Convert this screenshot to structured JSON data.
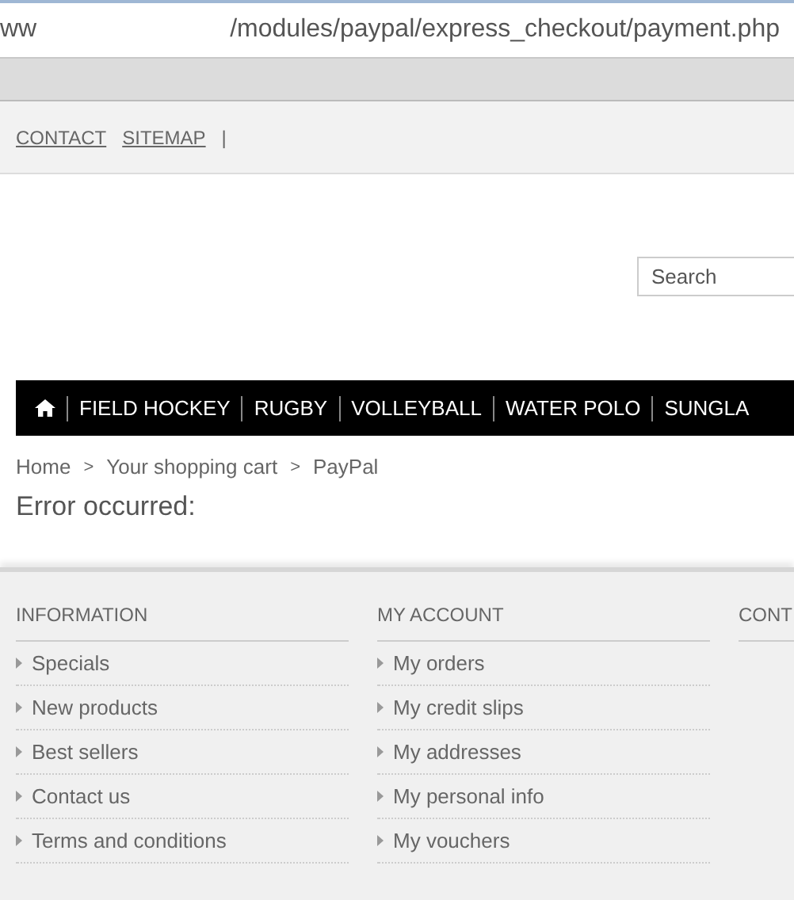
{
  "address_bar": {
    "prefix": "ww",
    "path": "/modules/paypal/express_checkout/payment.php"
  },
  "top_links": [
    "CONTACT",
    "SITEMAP"
  ],
  "top_separator": "|",
  "search": {
    "placeholder": "Search"
  },
  "nav": {
    "items": [
      "FIELD HOCKEY",
      "RUGBY",
      "VOLLEYBALL",
      "WATER POLO",
      "SUNGLA"
    ]
  },
  "breadcrumb": [
    "Home",
    "Your shopping cart",
    "PayPal"
  ],
  "breadcrumb_separator": ">",
  "message": "Error occurred:",
  "footer": {
    "columns": [
      {
        "title": "INFORMATION",
        "links": [
          "Specials",
          "New products",
          "Best sellers",
          "Contact us",
          "Terms and conditions"
        ]
      },
      {
        "title": "MY ACCOUNT",
        "links": [
          "My orders",
          "My credit slips",
          "My addresses",
          "My personal info",
          "My vouchers"
        ]
      },
      {
        "title": "CONT"
      }
    ]
  }
}
